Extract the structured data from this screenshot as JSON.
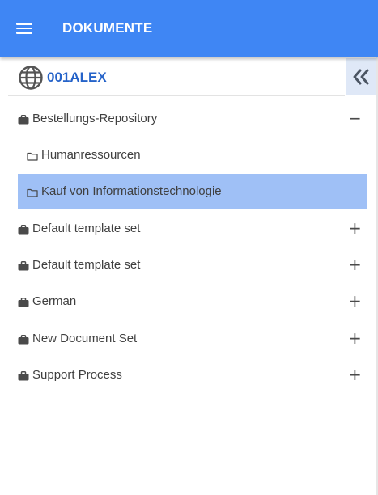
{
  "header": {
    "title": "DOKUMENTE",
    "menu_icon": "hamburger-menu-icon"
  },
  "org": {
    "name": "001ALEX",
    "icon": "globe-icon",
    "collapse_icon": "double-chevron-left-icon"
  },
  "tree": [
    {
      "label": "Bestellungs-Repository",
      "type": "briefcase",
      "level": 0,
      "toggle": "−",
      "expanded": true
    },
    {
      "label": "Humanressourcen",
      "type": "folder",
      "level": 1,
      "toggle": ""
    },
    {
      "label": "Kauf von Informationstechnologie",
      "type": "folder",
      "level": 1,
      "toggle": "",
      "selected": true
    },
    {
      "label": "Default template set",
      "type": "briefcase",
      "level": 0,
      "toggle": "+"
    },
    {
      "label": "Default template set",
      "type": "briefcase",
      "level": 0,
      "toggle": "+"
    },
    {
      "label": "German",
      "type": "briefcase",
      "level": 0,
      "toggle": "+"
    },
    {
      "label": "New Document Set",
      "type": "briefcase",
      "level": 0,
      "toggle": "+"
    },
    {
      "label": "Support Process",
      "type": "briefcase",
      "level": 0,
      "toggle": "+"
    }
  ],
  "colors": {
    "header_bg": "#3f86f4",
    "org_name": "#2563c9",
    "selected_row": "#9fc0f6",
    "collapse_button_bg": "#dfe8f7"
  }
}
